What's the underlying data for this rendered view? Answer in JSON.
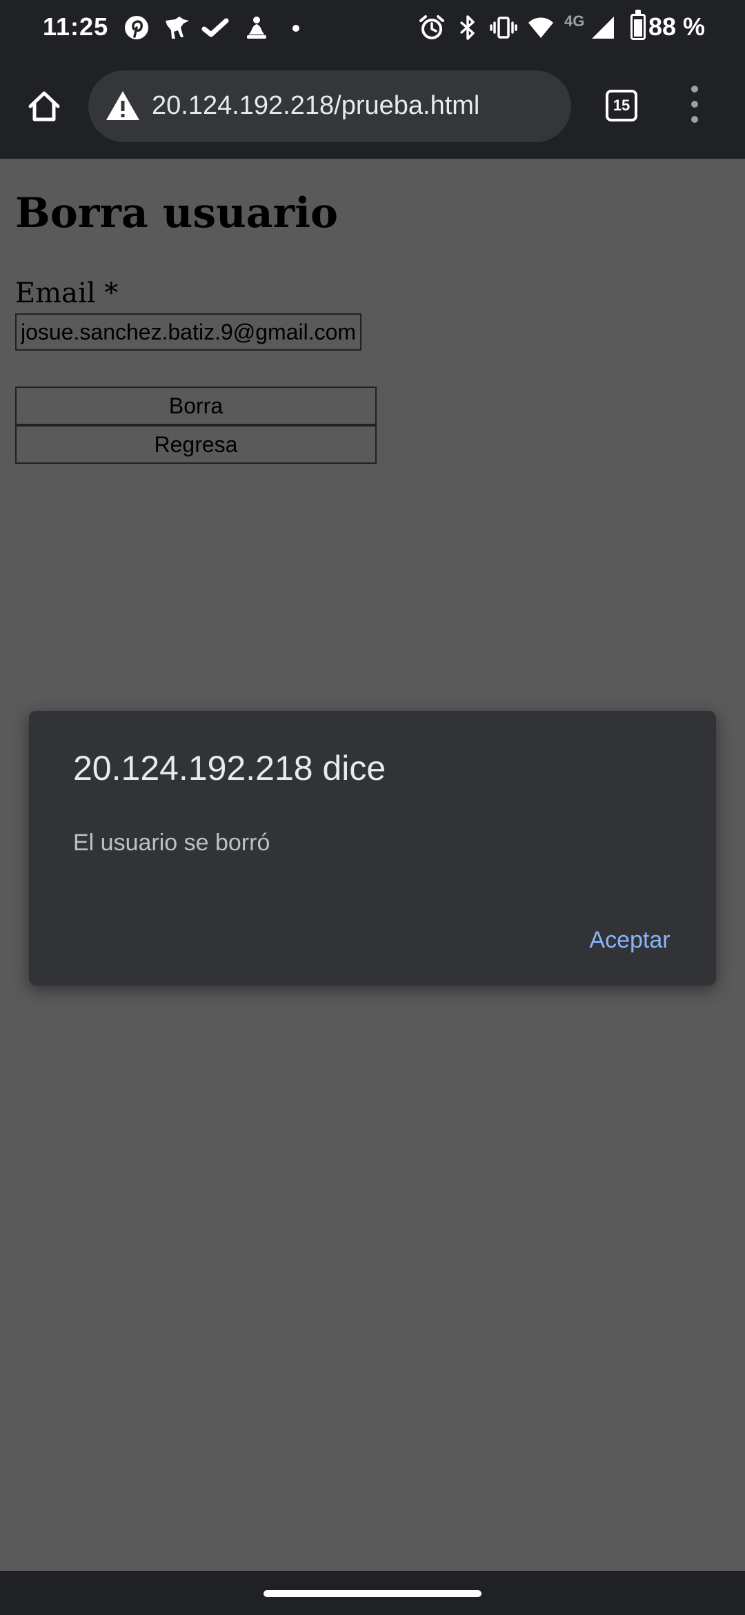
{
  "status_bar": {
    "time": "11:25",
    "network": "4G",
    "battery_percent": "88 %",
    "battery_level": 0.88,
    "left_icons": [
      "pinterest-icon",
      "dog-app-icon",
      "check-app-icon",
      "meditation-app-icon",
      "more-notifications-dot"
    ],
    "right_icons": [
      "alarm-icon",
      "bluetooth-icon",
      "vibrate-icon",
      "wifi-icon",
      "cell-signal-icon",
      "battery-icon"
    ]
  },
  "browser": {
    "url": "20.124.192.218/prueba.html",
    "tab_count": "15",
    "security_icon": "warning-icon"
  },
  "page": {
    "title": "Borra usuario",
    "email_label": "Email *",
    "email_value": "josue.sanchez.batiz.9@gmail.com",
    "delete_button": "Borra",
    "back_button": "Regresa"
  },
  "dialog": {
    "title": "20.124.192.218 dice",
    "message": "El usuario se borró",
    "ok_button": "Aceptar"
  },
  "colors": {
    "chrome_bar": "#202124",
    "url_bar": "#35363a",
    "page_dimmed": "#5a5a5a",
    "dialog_bg": "#323336",
    "dialog_accent": "#8ab4f8"
  }
}
